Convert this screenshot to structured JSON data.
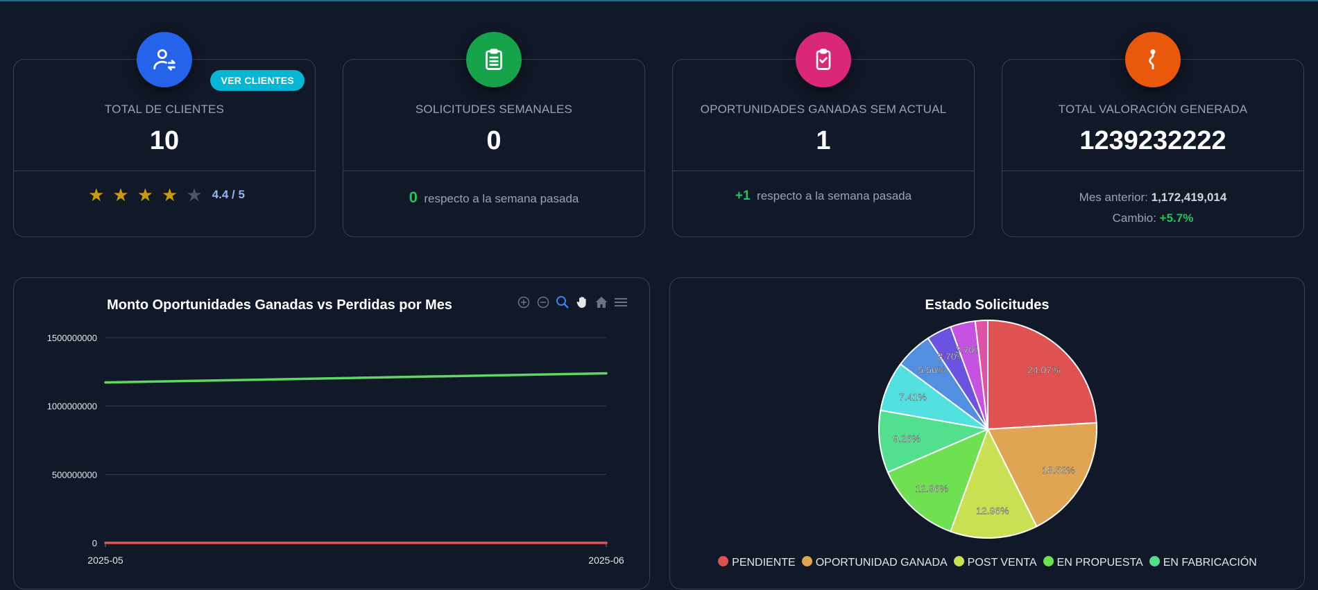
{
  "cards": [
    {
      "title": "TOTAL DE CLIENTES",
      "value": "10",
      "button": "VER CLIENTES",
      "icon": "user-refresh-icon",
      "color": "#2563eb",
      "rating": {
        "value": 4.4,
        "max": 5,
        "text": "4.4 / 5",
        "filled_stars": 4
      }
    },
    {
      "title": "SOLICITUDES SEMANALES",
      "value": "0",
      "icon": "clipboard-icon",
      "color": "#16a34a",
      "change": "0",
      "change_text": "respecto a la semana pasada"
    },
    {
      "title": "OPORTUNIDADES GANADAS SEM ACTUAL",
      "value": "1",
      "icon": "clipboard-check-icon",
      "color": "#db2777",
      "change": "+1",
      "change_text": "respecto a la semana pasada"
    },
    {
      "title": "TOTAL VALORACIÓN GENERADA",
      "value": "1239232222",
      "icon": "route-icon",
      "color": "#ea580c",
      "prev_label": "Mes anterior:",
      "prev_value": "1,172,419,014",
      "change_label": "Cambio:",
      "change_value": "+5.7%"
    }
  ],
  "line_chart": {
    "toolbar_icons": [
      "zoom-in-icon",
      "zoom-out-icon",
      "selection-zoom-icon",
      "pan-icon",
      "home-icon",
      "menu-icon"
    ]
  },
  "pie_chart": {},
  "chart_data": [
    {
      "type": "line",
      "title": "Monto Oportunidades Ganadas vs Perdidas por Mes",
      "x": [
        "2025-05",
        "2025-06"
      ],
      "ylim": [
        0,
        1500000000
      ],
      "yticks": [
        "0",
        "500000000",
        "1000000000",
        "1500000000"
      ],
      "grid": true,
      "series": [
        {
          "values": [
            1172419014,
            1239232222
          ],
          "color": "#5fd85f"
        },
        {
          "values": [
            0,
            0
          ],
          "color": "#e05555"
        }
      ]
    },
    {
      "type": "pie",
      "title": "Estado Solicitudes",
      "legend": "bottom",
      "slices": [
        {
          "label": "PENDIENTE",
          "value": 24.07,
          "text": "24.07%",
          "color": "#e05252"
        },
        {
          "label": "OPORTUNIDAD GANADA",
          "value": 18.52,
          "text": "18.52%",
          "color": "#e0a552"
        },
        {
          "label": "POST VENTA",
          "value": 12.96,
          "text": "12.96%",
          "color": "#c8e052"
        },
        {
          "label": "EN PROPUESTA",
          "value": 12.96,
          "text": "12.96%",
          "color": "#6ee052"
        },
        {
          "label": "EN FABRICACIÓN",
          "value": 9.26,
          "text": "9.26%",
          "color": "#52e08f",
          "legend": true
        },
        {
          "value": 7.41,
          "text": "7.41%",
          "color": "#52e0e0"
        },
        {
          "value": 5.56,
          "text": "5.56%",
          "color": "#528fe0"
        },
        {
          "value": 3.7,
          "text": "3.70%",
          "color": "#6b52e0"
        },
        {
          "value": 3.7,
          "text": "3.70%",
          "color": "#c552e0"
        },
        {
          "value": 1.85,
          "text": "",
          "color": "#e052a5"
        }
      ]
    }
  ]
}
